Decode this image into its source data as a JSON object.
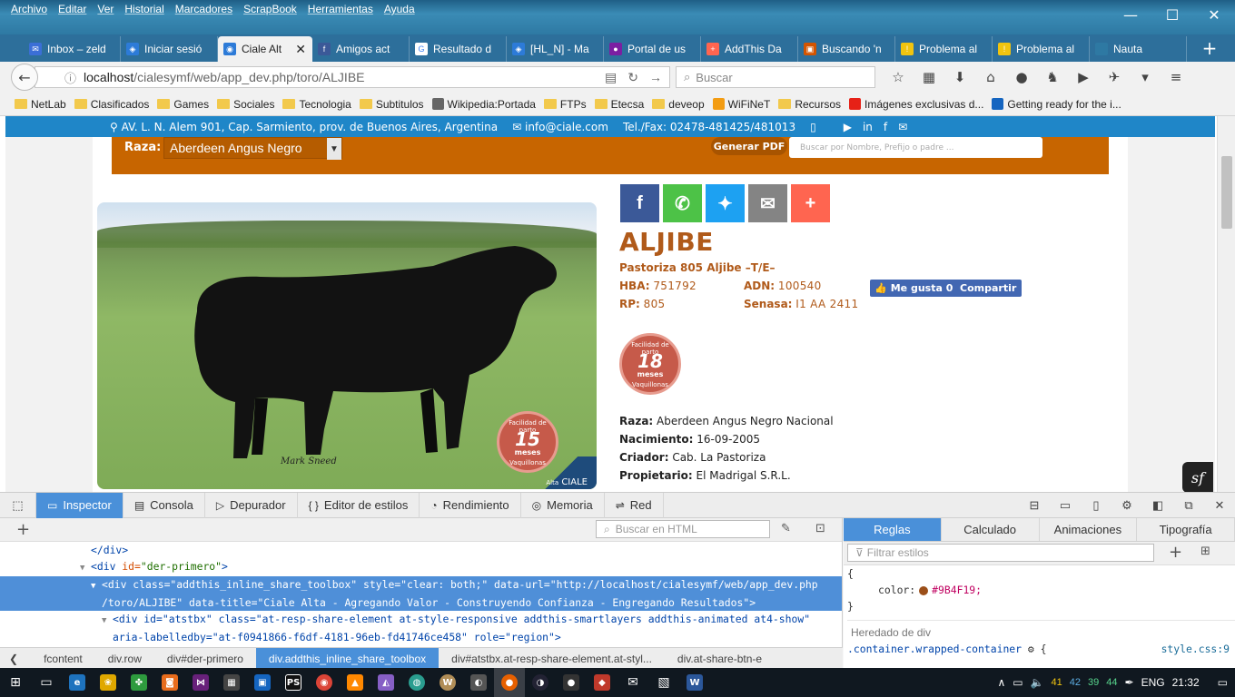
{
  "menu": [
    "Archivo",
    "Editar",
    "Ver",
    "Historial",
    "Marcadores",
    "ScrapBook",
    "Herramientas",
    "Ayuda"
  ],
  "tabs": [
    {
      "label": "Inbox – zeld",
      "fav_color": "#3b6fd6",
      "fav_glyph": "✉"
    },
    {
      "label": "Iniciar sesió",
      "fav_color": "#2d7bd8",
      "fav_glyph": "◈"
    },
    {
      "label": "Ciale Alt",
      "fav_color": "#2d7bd8",
      "fav_glyph": "◉",
      "active": true
    },
    {
      "label": "Amigos act",
      "fav_color": "#3b5998",
      "fav_glyph": "f"
    },
    {
      "label": "Resultado d",
      "fav_color": "#ffffff",
      "fav_glyph": "G"
    },
    {
      "label": "[HL_N] - Ma",
      "fav_color": "#2d7bd8",
      "fav_glyph": "◈"
    },
    {
      "label": "Portal de us",
      "fav_color": "#7b1fa2",
      "fav_glyph": "●"
    },
    {
      "label": "AddThis Da",
      "fav_color": "#ff6550",
      "fav_glyph": "+"
    },
    {
      "label": "Buscando 'n",
      "fav_color": "#d35400",
      "fav_glyph": "▣"
    },
    {
      "label": "Problema al",
      "fav_color": "#f1c40f",
      "fav_glyph": "!"
    },
    {
      "label": "Problema al",
      "fav_color": "#f1c40f",
      "fav_glyph": "!"
    },
    {
      "label": "Nauta",
      "fav_color": "#2e79a3",
      "fav_glyph": ""
    }
  ],
  "nav": {
    "url_host": "localhost",
    "url_path": "/cialesymf/web/app_dev.php/toro/ALJIBE",
    "search_placeholder": "Buscar"
  },
  "bookmarks": [
    {
      "label": "NetLab",
      "type": "folder"
    },
    {
      "label": "Clasificados",
      "type": "folder"
    },
    {
      "label": "Games",
      "type": "folder"
    },
    {
      "label": "Sociales",
      "type": "folder"
    },
    {
      "label": "Tecnologia",
      "type": "folder"
    },
    {
      "label": "Subtitulos",
      "type": "folder"
    },
    {
      "label": "Wikipedia:Portada",
      "type": "site",
      "color": "#666666"
    },
    {
      "label": "FTPs",
      "type": "folder"
    },
    {
      "label": "Etecsa",
      "type": "folder"
    },
    {
      "label": "deveop",
      "type": "folder"
    },
    {
      "label": "WiFiNeT",
      "type": "site",
      "color": "#f39c12"
    },
    {
      "label": "Recursos",
      "type": "folder"
    },
    {
      "label": "Imágenes exclusivas d...",
      "type": "site",
      "color": "#e62117"
    },
    {
      "label": "Getting ready for the i...",
      "type": "site",
      "color": "#1565c0"
    }
  ],
  "page": {
    "address": "AV. L. N. Alem 901, Cap. Sarmiento, prov. de Buenos Aires, Argentina",
    "email": "info@ciale.com",
    "phone": "Tel./Fax: 02478-481425/481013",
    "raza_label": "Raza:",
    "raza_value": "Aberdeen Angus Negro",
    "pdf_button": "Generar PDF",
    "search_placeholder": "Buscar por Nombre, Prefijo o padre ...",
    "photo_credit": "Mark Sneed",
    "photo_badge": {
      "top": "Facilidad de parto",
      "num": "15",
      "unit": "meses",
      "bottom": "Vaquillonas"
    },
    "logo_text": "CIALE",
    "logo_sub": "Alta",
    "share_buttons": [
      {
        "name": "facebook",
        "glyph": "f",
        "color": "#3b5998"
      },
      {
        "name": "whatsapp",
        "glyph": "✆",
        "color": "#4dc247"
      },
      {
        "name": "twitter",
        "glyph": "✦",
        "color": "#1da1f2"
      },
      {
        "name": "email",
        "glyph": "✉",
        "color": "#848484"
      },
      {
        "name": "more",
        "glyph": "+",
        "color": "#ff6550"
      }
    ],
    "animal_name": "ALJIBE",
    "animal_full": "Pastoriza 805 Aljibe –T/E–",
    "hba_label": "HBA:",
    "hba": "751792",
    "adn_label": "ADN:",
    "adn": "100540",
    "rp_label": "RP:",
    "rp": "805",
    "senasa_label": "Senasa:",
    "senasa": "I1 AA 2411",
    "like_label": "Me gusta 0",
    "share_label": "Compartir",
    "badge": {
      "top": "Facilidad de parto",
      "num": "18",
      "unit": "meses",
      "bottom": "Vaquillonas"
    },
    "details": [
      {
        "label": "Raza:",
        "value": "Aberdeen Angus Negro Nacional"
      },
      {
        "label": "Nacimiento:",
        "value": "16-09-2005"
      },
      {
        "label": "Criador:",
        "value": "Cab. La Pastoriza"
      },
      {
        "label": "Propietario:",
        "value": "El Madrigal S.R.L."
      }
    ],
    "accent_color": "#c76500",
    "name_color": "#b05a1a"
  },
  "devtools": {
    "tabs": [
      "Inspector",
      "Consola",
      "Depurador",
      "Editor de estilos",
      "Rendimiento",
      "Memoria",
      "Red"
    ],
    "html_search_placeholder": "Buscar en HTML",
    "markup": {
      "l1": "</div>",
      "l2_tag": "<div",
      "l2_an": "id=",
      "l2_av": "\"der-primero\"",
      "l2_end": ">",
      "l3": "<div class=\"addthis_inline_share_toolbox\" style=\"clear: both;\" data-url=\"http://localhost/cialesymf/web/app_dev.php",
      "l4": "/toro/ALJIBE\" data-title=\"Ciale Alta - Agregando Valor - Construyendo Confianza - Engregando Resultados\">",
      "l5": "<div id=\"atstbx\" class=\"at-resp-share-element at-style-responsive addthis-smartlayers addthis-animated at4-show\"",
      "l6": "aria-labelledby=\"at-f0941866-f6df-4181-96eb-fd41746ce458\" role=\"region\">"
    },
    "breadcrumbs": [
      "fcontent",
      "div.row",
      "div#der-primero",
      "div.addthis_inline_share_toolbox",
      "div#atstbx.at-resp-share-element.at-styl...",
      "div.at-share-btn-e"
    ],
    "right_tabs": [
      "Reglas",
      "Calculado",
      "Animaciones",
      "Tipografía"
    ],
    "filter_placeholder": "Filtrar estilos",
    "rule_open": "{",
    "prop_name": "color:",
    "prop_value": "#9B4F19;",
    "rule_close": "}",
    "inherited": "Heredado de div",
    "selector": ".container.wrapped-container",
    "selector_brace": "{",
    "source": "style.css:9"
  },
  "taskbar": {
    "tray_nums": [
      "41",
      "42",
      "39",
      "44"
    ],
    "lang": "ENG",
    "time": "21:32"
  }
}
